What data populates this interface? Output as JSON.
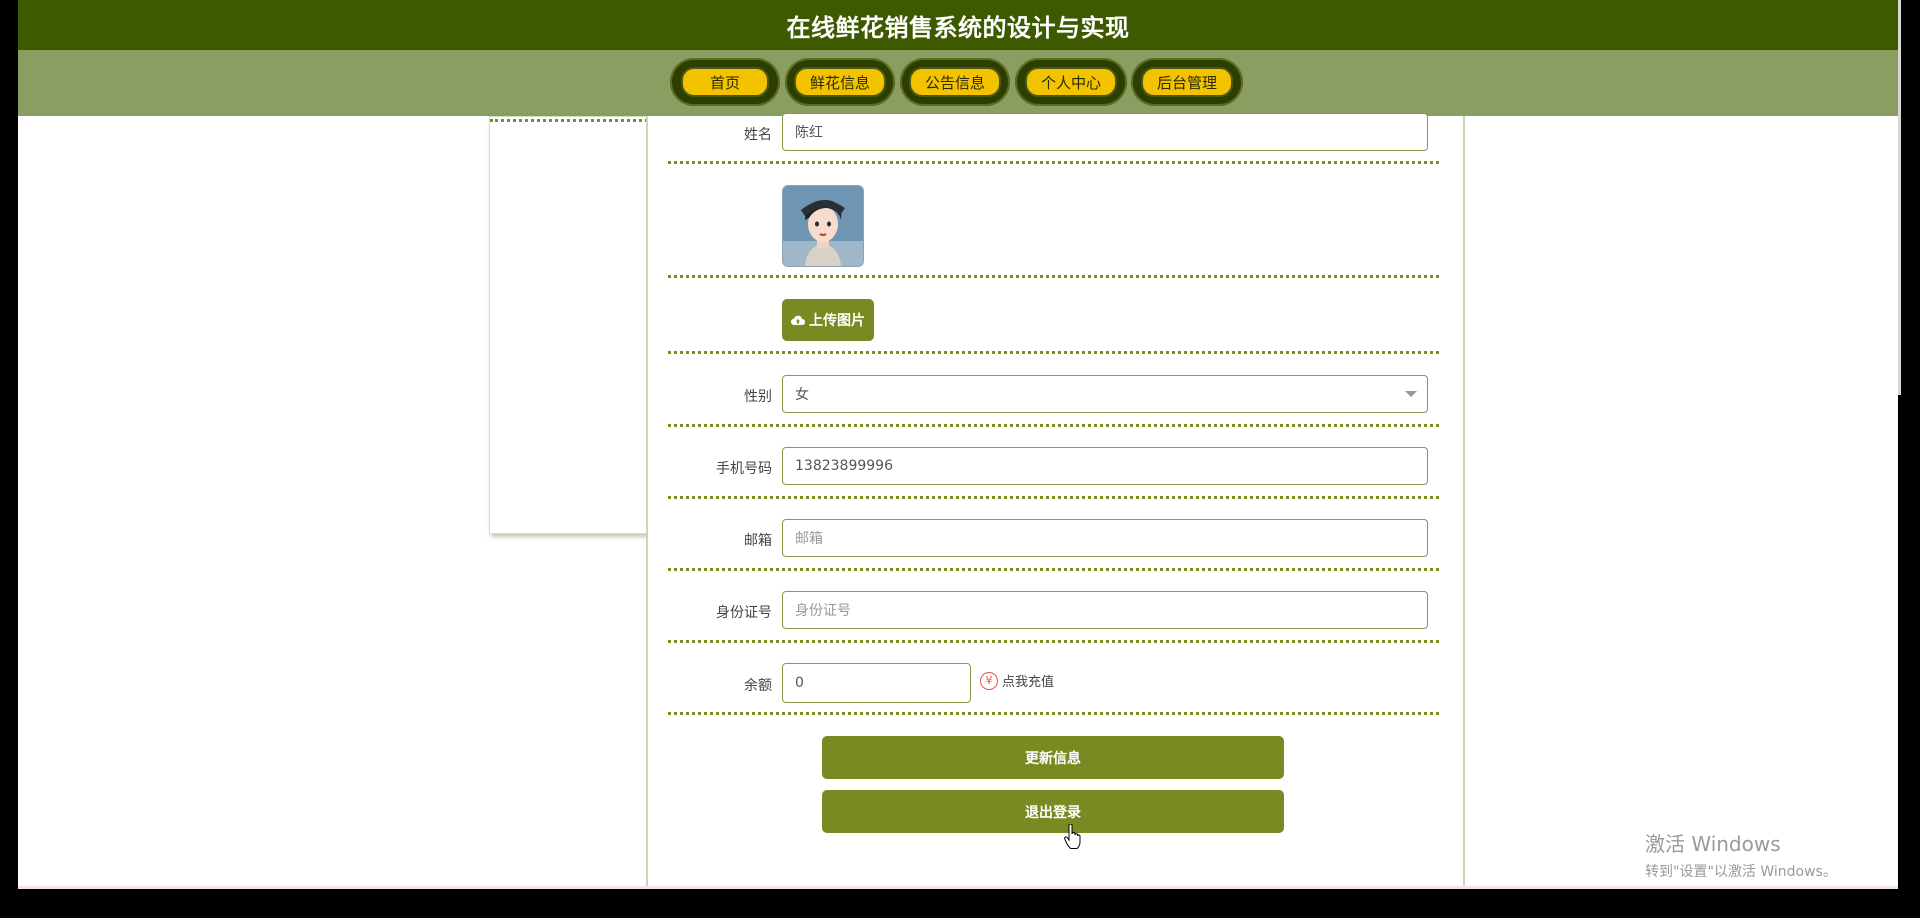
{
  "header": {
    "title": "在线鲜花销售系统的设计与实现"
  },
  "nav": {
    "items": [
      {
        "label": "首页"
      },
      {
        "label": "鲜花信息"
      },
      {
        "label": "公告信息"
      },
      {
        "label": "个人中心"
      },
      {
        "label": "后台管理"
      }
    ]
  },
  "form": {
    "name_label": "姓名",
    "name_value": "陈红",
    "upload_label": "上传图片",
    "gender_label": "性别",
    "gender_value": "女",
    "phone_label": "手机号码",
    "phone_value": "13823899996",
    "email_label": "邮箱",
    "email_placeholder": "邮箱",
    "idcard_label": "身份证号",
    "idcard_placeholder": "身份证号",
    "balance_label": "余额",
    "balance_value": "0",
    "recharge_label": "点我充值"
  },
  "actions": {
    "update_label": "更新信息",
    "logout_label": "退出登录"
  },
  "watermark": {
    "line1": "激活 Windows",
    "line2": "转到\"设置\"以激活 Windows。"
  },
  "colors": {
    "title_bg": "#3e5a00",
    "nav_bg": "#8a9e62",
    "accent": "#7a8a22",
    "nav_pill": "#f3c300"
  },
  "icons": {
    "upload": "cloud-upload-icon",
    "recharge": "yen-icon",
    "cursor": "hand-pointer-icon"
  }
}
